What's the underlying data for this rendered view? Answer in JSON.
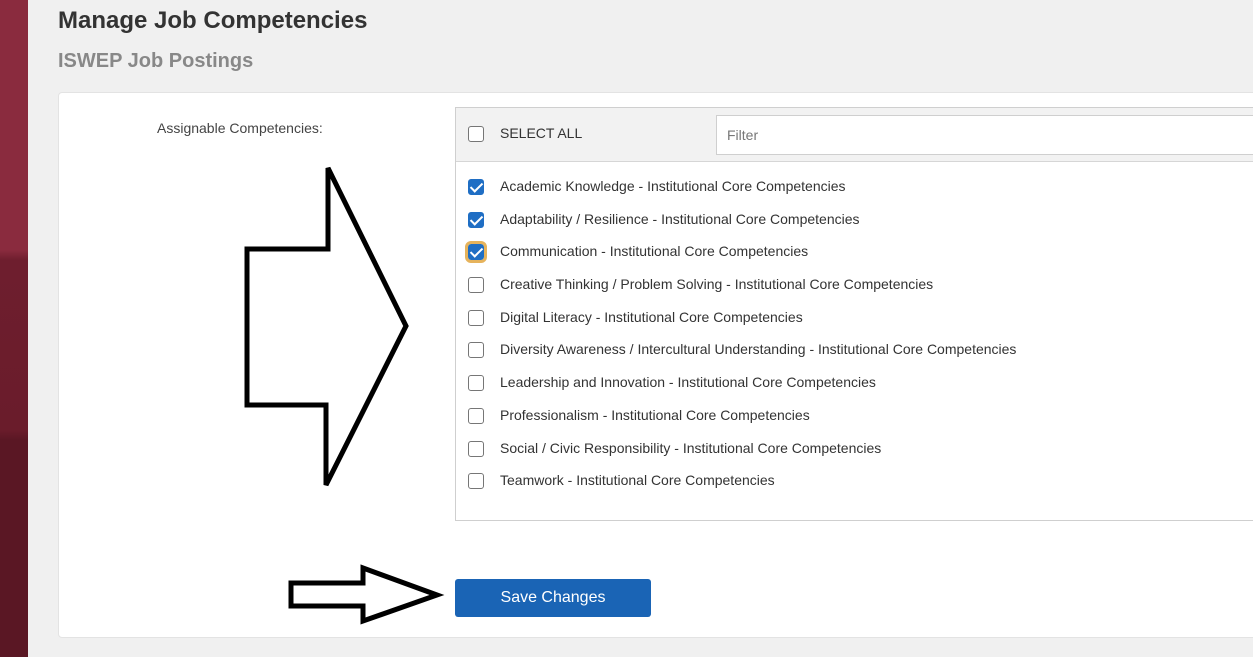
{
  "page": {
    "title": "Manage Job Competencies",
    "subtitle": "ISWEP Job Postings"
  },
  "form": {
    "field_label": "Assignable Competencies:",
    "select_all_label": "SELECT ALL",
    "select_all_checked": false,
    "filter_placeholder": "Filter",
    "filter_value": ""
  },
  "competencies": [
    {
      "label": "Academic Knowledge - Institutional Core Competencies",
      "checked": true
    },
    {
      "label": "Adaptability / Resilience - Institutional Core Competencies",
      "checked": true
    },
    {
      "label": "Communication - Institutional Core Competencies",
      "checked": true
    },
    {
      "label": "Creative Thinking / Problem Solving - Institutional Core Competencies",
      "checked": false
    },
    {
      "label": "Digital Literacy - Institutional Core Competencies",
      "checked": false
    },
    {
      "label": "Diversity Awareness / Intercultural Understanding - Institutional Core Competencies",
      "checked": false
    },
    {
      "label": "Leadership and Innovation - Institutional Core Competencies",
      "checked": false
    },
    {
      "label": "Professionalism - Institutional Core Competencies",
      "checked": false
    },
    {
      "label": "Social / Civic Responsibility - Institutional Core Competencies",
      "checked": false
    },
    {
      "label": "Teamwork - Institutional Core Competencies",
      "checked": false
    }
  ],
  "focused_item": "Communication - Institutional Core Competencies",
  "actions": {
    "save_label": "Save Changes"
  },
  "colors": {
    "accent_sidebar": "#8a2b3e",
    "checkbox_checked": "#1f6ec4",
    "focus_outline": "#e6b35c",
    "save_button": "#1a64b5"
  },
  "annotations": [
    "right-arrow-large",
    "right-arrow-small"
  ]
}
